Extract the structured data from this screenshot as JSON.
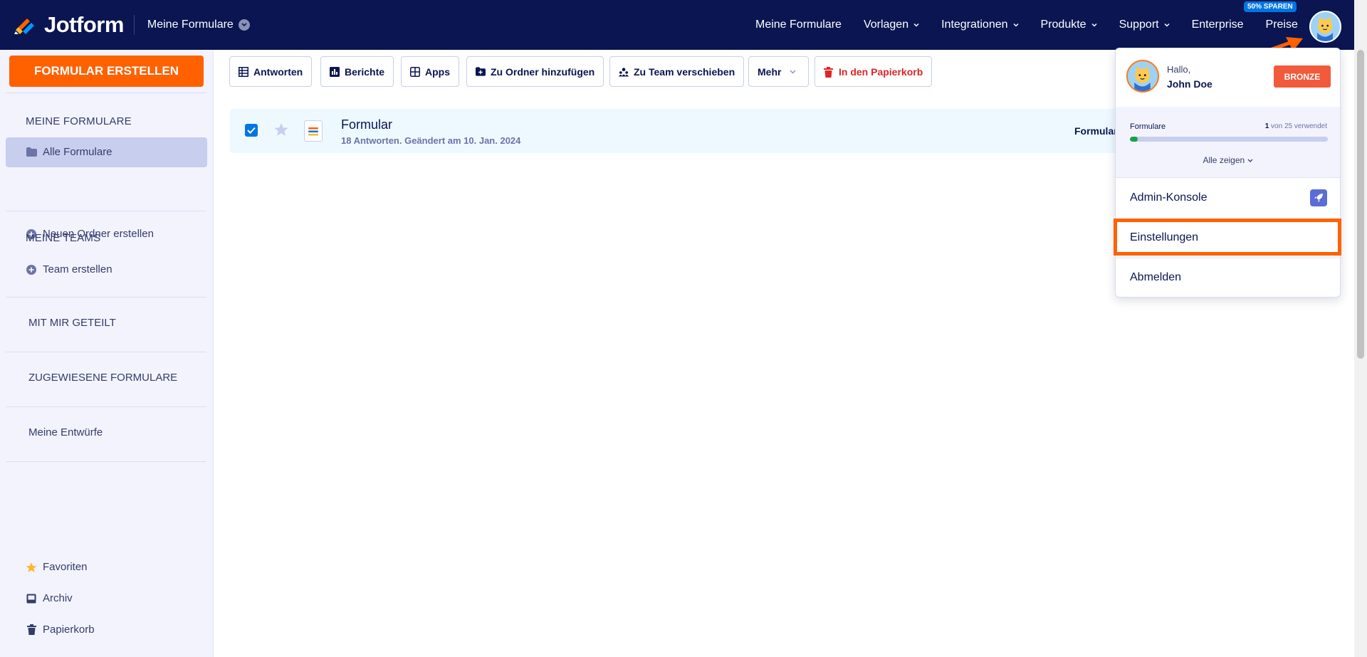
{
  "app": {
    "brand": "Jotform"
  },
  "topnav": {
    "switcher_label": "Meine Formulare",
    "links": [
      {
        "label": "Meine Formulare",
        "has_dropdown": false
      },
      {
        "label": "Vorlagen",
        "has_dropdown": true
      },
      {
        "label": "Integrationen",
        "has_dropdown": true
      },
      {
        "label": "Produkte",
        "has_dropdown": true
      },
      {
        "label": "Support",
        "has_dropdown": true
      },
      {
        "label": "Enterprise",
        "has_dropdown": false
      },
      {
        "label": "Preise",
        "has_dropdown": false
      }
    ],
    "save_badge": "50% SPAREN"
  },
  "sidebar": {
    "create_button": "FORMULAR ERSTELLEN",
    "my_forms_heading": "MEINE FORMULARE",
    "all_forms": "Alle Formulare",
    "new_folder": "Neuen Ordner erstellen",
    "my_teams_heading": "MEINE TEAMS",
    "create_team": "Team erstellen",
    "shared_with_me": "MIT MIR GETEILT",
    "assigned_forms": "ZUGEWIESENE FORMULARE",
    "my_drafts": "Meine Entwürfe",
    "favorites": "Favoriten",
    "archive": "Archiv",
    "trash": "Papierkorb"
  },
  "toolbar": {
    "responses": "Antworten",
    "reports": "Berichte",
    "apps": "Apps",
    "add_to_folder": "Zu Ordner hinzufügen",
    "move_to_team": "Zu Team verschieben",
    "more": "Mehr",
    "trash": "In den Papierkorb"
  },
  "form_list": [
    {
      "title": "Formular",
      "meta": "18 Antworten. Geändert am 10. Jan. 2024",
      "checked": true,
      "starred": false,
      "action_partial": "Formular"
    }
  ],
  "account_menu": {
    "greeting": "Hallo,",
    "name": "John Doe",
    "plan": "BRONZE",
    "usage_label": "Formulare",
    "usage_used": "1",
    "usage_text": " von 25 verwendet",
    "usage_fraction": 0.04,
    "show_all": "Alle zeigen",
    "admin_console": "Admin-Konsole",
    "settings": "Einstellungen",
    "logout": "Abmelden"
  },
  "colors": {
    "nav_bg": "#0a1551",
    "accent_orange": "#ff6100",
    "accent_blue": "#0075e3",
    "danger": "#dc2626",
    "plan_badge": "#f15a3b",
    "usage_fill": "#15a249"
  }
}
